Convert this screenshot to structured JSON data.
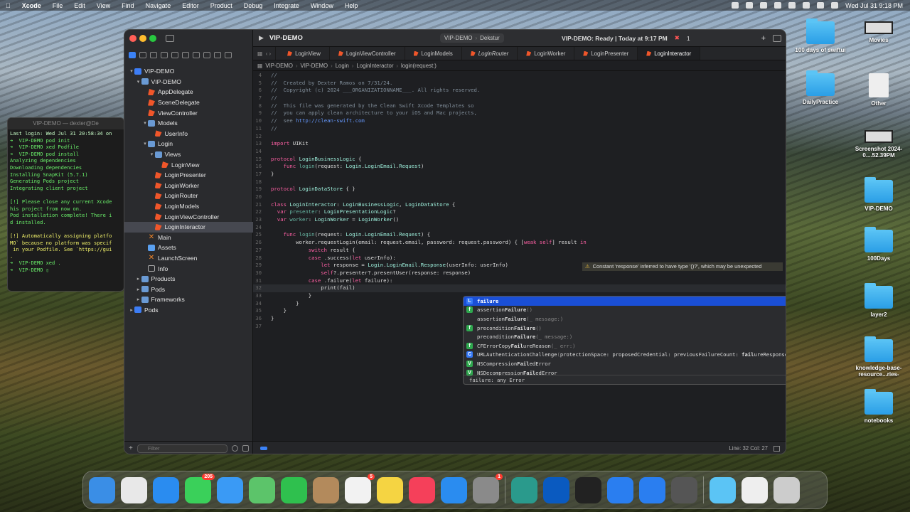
{
  "menubar": {
    "app": "Xcode",
    "items": [
      "File",
      "Edit",
      "View",
      "Find",
      "Navigate",
      "Editor",
      "Product",
      "Debug",
      "Integrate",
      "Window",
      "Help"
    ],
    "clock": "Wed Jul 31  9:18 PM"
  },
  "terminal": {
    "title": "VIP-DEMO — dexter@De",
    "lines": [
      {
        "t": "Last login: Wed Jul 31 20:58:34 on",
        "c": ""
      },
      {
        "t": "➜  VIP-DEMO pod init",
        "c": "tl-g"
      },
      {
        "t": "➜  VIP-DEMO xed Podfile",
        "c": "tl-g"
      },
      {
        "t": "➜  VIP-DEMO pod install",
        "c": "tl-g"
      },
      {
        "t": "Analyzing dependencies",
        "c": "tl-g"
      },
      {
        "t": "Downloading dependencies",
        "c": "tl-g"
      },
      {
        "t": "Installing SnapKit (5.7.1)",
        "c": "tl-g"
      },
      {
        "t": "Generating Pods project",
        "c": "tl-g"
      },
      {
        "t": "Integrating client project",
        "c": "tl-g"
      },
      {
        "t": "",
        "c": ""
      },
      {
        "t": "[!] Please close any current Xcode",
        "c": "tl-g"
      },
      {
        "t": "his project from now on.",
        "c": "tl-g"
      },
      {
        "t": "Pod installation complete! There i",
        "c": "tl-g"
      },
      {
        "t": "d installed.",
        "c": "tl-g"
      },
      {
        "t": "",
        "c": ""
      },
      {
        "t": "[!] Automatically assigning platfo",
        "c": "tl-y"
      },
      {
        "t": "MO` because no platform was specif",
        "c": "tl-y"
      },
      {
        "t": " in your Podfile. See `https://gui",
        "c": "tl-y"
      },
      {
        "t": ".",
        "c": "tl-y"
      },
      {
        "t": "➜  VIP-DEMO xed .",
        "c": "tl-g"
      },
      {
        "t": "➜  VIP-DEMO ▯",
        "c": "tl-g"
      }
    ]
  },
  "xcode": {
    "project_title": "VIP-DEMO",
    "scheme": "VIP-DEMO",
    "destination": "Dekstur",
    "status": "VIP-DEMO: Ready | Today at 9:17 PM",
    "error_count": "1",
    "warning_count": "1",
    "tabs": [
      "LoginView",
      "LoginViewController",
      "LoginModels",
      "LoginRouter",
      "LoginWorker",
      "LoginPresenter",
      "LoginInteractor"
    ],
    "active_tab": "LoginInteractor",
    "jumpbar": [
      "VIP-DEMO",
      "VIP-DEMO",
      "Login",
      "LoginInteractor",
      "login(request:)"
    ],
    "navigator": [
      {
        "label": "VIP-DEMO",
        "depth": 0,
        "icon": "proj",
        "open": "▾"
      },
      {
        "label": "VIP-DEMO",
        "depth": 1,
        "icon": "folder",
        "open": "▾"
      },
      {
        "label": "AppDelegate",
        "depth": 2,
        "icon": "swift",
        "open": ""
      },
      {
        "label": "SceneDelegate",
        "depth": 2,
        "icon": "swift",
        "open": ""
      },
      {
        "label": "ViewController",
        "depth": 2,
        "icon": "swift",
        "open": ""
      },
      {
        "label": "Models",
        "depth": 2,
        "icon": "folder",
        "open": "▾"
      },
      {
        "label": "UserInfo",
        "depth": 3,
        "icon": "swift",
        "open": ""
      },
      {
        "label": "Login",
        "depth": 2,
        "icon": "folder",
        "open": "▾"
      },
      {
        "label": "Views",
        "depth": 3,
        "icon": "folder",
        "open": "▾"
      },
      {
        "label": "LoginView",
        "depth": 4,
        "icon": "swift",
        "open": ""
      },
      {
        "label": "LoginPresenter",
        "depth": 3,
        "icon": "swift",
        "open": ""
      },
      {
        "label": "LoginWorker",
        "depth": 3,
        "icon": "swift",
        "open": ""
      },
      {
        "label": "LoginRouter",
        "depth": 3,
        "icon": "swift",
        "open": ""
      },
      {
        "label": "LoginModels",
        "depth": 3,
        "icon": "swift",
        "open": ""
      },
      {
        "label": "LoginViewController",
        "depth": 3,
        "icon": "swift",
        "open": ""
      },
      {
        "label": "LoginInteractor",
        "depth": 3,
        "icon": "swift",
        "open": "",
        "selected": true
      },
      {
        "label": "Main",
        "depth": 2,
        "icon": "xib",
        "open": ""
      },
      {
        "label": "Assets",
        "depth": 2,
        "icon": "assets",
        "open": ""
      },
      {
        "label": "LaunchScreen",
        "depth": 2,
        "icon": "xib",
        "open": ""
      },
      {
        "label": "Info",
        "depth": 2,
        "icon": "plist",
        "open": ""
      },
      {
        "label": "Products",
        "depth": 1,
        "icon": "folder",
        "open": "▸"
      },
      {
        "label": "Pods",
        "depth": 1,
        "icon": "folder",
        "open": "▸"
      },
      {
        "label": "Frameworks",
        "depth": 1,
        "icon": "folder",
        "open": "▸"
      },
      {
        "label": "Pods",
        "depth": 0,
        "icon": "proj",
        "open": "▸"
      }
    ],
    "filter_placeholder": "Filter",
    "code": [
      {
        "n": "4",
        "h": "<span class='cm'>//</span>"
      },
      {
        "n": "5",
        "h": "<span class='cm'>//  Created by Dexter Ramos on 7/31/24.</span>"
      },
      {
        "n": "6",
        "h": "<span class='cm'>//  Copyright (c) 2024 ___ORGANIZATIONNAME___. All rights reserved.</span>"
      },
      {
        "n": "7",
        "h": "<span class='cm'>//</span>"
      },
      {
        "n": "8",
        "h": "<span class='cm'>//  This file was generated by the Clean Swift Xcode Templates so</span>"
      },
      {
        "n": "9",
        "h": "<span class='cm'>//  you can apply clean architecture to your iOS and Mac projects,</span>"
      },
      {
        "n": "10",
        "h": "<span class='cm'>//  see </span><span class='lnk'>http://clean-swift.com</span>"
      },
      {
        "n": "11",
        "h": "<span class='cm'>//</span>"
      },
      {
        "n": "12",
        "h": ""
      },
      {
        "n": "13",
        "h": "<span class='k'>import</span> UIKit"
      },
      {
        "n": "14",
        "h": ""
      },
      {
        "n": "15",
        "h": "<span class='k'>protocol</span> <span class='ty'>LoginBusinessLogic</span> {"
      },
      {
        "n": "16",
        "h": "    <span class='k'>func</span> <span class='fn'>login</span>(request: <span class='ty'>Login</span>.<span class='ty'>LoginEmail</span>.<span class='ty'>Request</span>)"
      },
      {
        "n": "17",
        "h": "}"
      },
      {
        "n": "18",
        "h": ""
      },
      {
        "n": "19",
        "h": "<span class='k'>protocol</span> <span class='ty'>LoginDataStore</span> { }"
      },
      {
        "n": "20",
        "h": ""
      },
      {
        "n": "21",
        "h": "<span class='k'>class</span> <span class='ty'>LoginInteractor</span>: <span class='ty'>LoginBusinessLogic</span>, <span class='ty'>LoginDataStore</span> {"
      },
      {
        "n": "22",
        "h": "  <span class='k'>var</span> <span class='fn'>presenter</span>: <span class='ty'>LoginPresentationLogic</span>?"
      },
      {
        "n": "23",
        "h": "  <span class='k'>var</span> <span class='fn'>worker</span>: <span class='ty'>LoginWorker</span> = <span class='ty'>LoginWorker</span>()"
      },
      {
        "n": "24",
        "h": ""
      },
      {
        "n": "25",
        "h": "    <span class='k'>func</span> <span class='fn'>login</span>(request: <span class='ty'>Login</span>.<span class='ty'>LoginEmail</span>.<span class='ty'>Request</span>) {"
      },
      {
        "n": "26",
        "h": "        worker.requestLogin(email: request.email, password: request.password) { [<span class='k'>weak self</span>] result <span class='k'>in</span>"
      },
      {
        "n": "27",
        "h": "            <span class='k'>switch</span> result {"
      },
      {
        "n": "28",
        "h": "            <span class='k'>case</span> .success(<span class='k'>let</span> userInfo):"
      },
      {
        "n": "29",
        "h": "                <span class='k'>let</span> response = <span class='ty'>Login</span>.<span class='ty'>LoginEmail</span>.<span class='ty'>Response</span>(userInfo: userInfo)"
      },
      {
        "n": "30",
        "h": "                <span class='k'>self</span>?.presenter?.presentUser(response: response)"
      },
      {
        "n": "31",
        "h": "            <span class='k'>case</span> .failure(<span class='k'>let</span> failure):"
      },
      {
        "n": "32",
        "h": "                print(fail)",
        "cur": true
      },
      {
        "n": "33",
        "h": "            }"
      },
      {
        "n": "34",
        "h": "        }"
      },
      {
        "n": "35",
        "h": "    }"
      },
      {
        "n": "36",
        "h": "}"
      },
      {
        "n": "37",
        "h": ""
      }
    ],
    "warning": "Constant 'response' inferred to have type '()?', which may be unexpected",
    "autocomplete": [
      {
        "b": "L",
        "c": "#3478f6",
        "h": "<b>failure</b>",
        "sel": true
      },
      {
        "b": "f",
        "c": "#2fa84f",
        "h": "assertion<b>Failure</b><span class='dim'>()</span>"
      },
      {
        "b": "",
        "c": "",
        "h": "assertion<b>Failure</b><span class='dim'>(_ message:)</span>"
      },
      {
        "b": "f",
        "c": "#2fa84f",
        "h": "precondition<b>Failure</b><span class='dim'>()</span>"
      },
      {
        "b": "",
        "c": "",
        "h": "precondition<b>Failure</b><span class='dim'>(_ message:)</span>"
      },
      {
        "b": "f",
        "c": "#2fa84f",
        "h": "CFErrorCopy<b>Fail</b>ureReason<span class='dim'>(_ err:)</span>"
      },
      {
        "b": "C",
        "c": "#3478f6",
        "h": "URLAuthenticationChallenge<span class='dim'>(</span>protectionSpace: proposedCredential: previousFailureCount: <b>fail</b>ureResponse: error: sender:<span class='dim'>)</span>"
      },
      {
        "b": "V",
        "c": "#2fa84f",
        "h": "NSCompression<b>Fail</b>edError"
      },
      {
        "b": "V",
        "c": "#2fa84f",
        "h": "NSDecompression<b>Fail</b>edError"
      }
    ],
    "autocomplete_footer": "failure: any Error",
    "cursor_pos": "Line: 32  Col: 27"
  },
  "desktop": [
    {
      "label": "100 days of swiftui",
      "kind": "fold"
    },
    {
      "label": "Movies",
      "kind": "shot"
    },
    {
      "label": "DailyPractice",
      "kind": "fold"
    },
    {
      "label": "Other",
      "kind": "file"
    },
    {
      "label": "Screenshot 2024-0....52.39PM",
      "kind": "shot"
    },
    {
      "label": "VIP-DEMO",
      "kind": "fold"
    },
    {
      "label": "100Days",
      "kind": "fold"
    },
    {
      "label": "layer2",
      "kind": "fold"
    },
    {
      "label": "knowledge-base-resource...ries-",
      "kind": "fold"
    },
    {
      "label": "notebooks",
      "kind": "fold"
    }
  ],
  "dock": [
    {
      "name": "finder-icon",
      "color": "#3a8ee6"
    },
    {
      "name": "launchpad-icon",
      "color": "#e8e8e8"
    },
    {
      "name": "safari-icon",
      "color": "#2a8cf0"
    },
    {
      "name": "messages-icon",
      "color": "#3ad05a",
      "badge": "205"
    },
    {
      "name": "mail-icon",
      "color": "#3a9af5"
    },
    {
      "name": "maps-icon",
      "color": "#5cc46a"
    },
    {
      "name": "facetime-icon",
      "color": "#2fc04e"
    },
    {
      "name": "contacts-icon",
      "color": "#b38a5c"
    },
    {
      "name": "reminders-icon",
      "color": "#f2f2f2",
      "badge": "5"
    },
    {
      "name": "notes-icon",
      "color": "#f5d442"
    },
    {
      "name": "music-icon",
      "color": "#f5405a"
    },
    {
      "name": "appstore-icon",
      "color": "#2a8cf0"
    },
    {
      "name": "settings-icon",
      "color": "#8a8a8a",
      "badge": "1"
    },
    {
      "name": "edge-icon",
      "color": "#2a9a8c"
    },
    {
      "name": "teamviewer-icon",
      "color": "#0a5ac0"
    },
    {
      "name": "terminal-icon",
      "color": "#222222"
    },
    {
      "name": "xcode-icon",
      "color": "#2a7ef0"
    },
    {
      "name": "instruments-icon",
      "color": "#2a7ef0"
    },
    {
      "name": "quicktime-icon",
      "color": "#555555"
    },
    {
      "name": "downloads-icon",
      "color": "#5bc4f5"
    },
    {
      "name": "document-icon",
      "color": "#eeeeee"
    },
    {
      "name": "trash-icon",
      "color": "#cccccc"
    }
  ]
}
